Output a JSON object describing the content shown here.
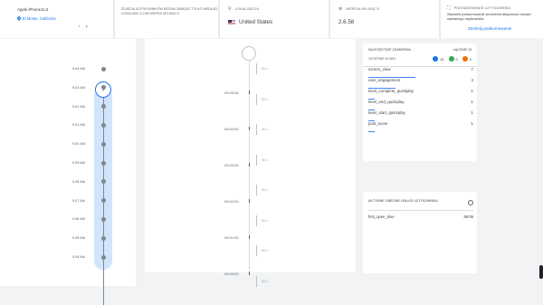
{
  "device": {
    "name": "Apple iPhone11,6",
    "location": "El Monte, California",
    "prev": "‹",
    "next": "›"
  },
  "notice": {
    "text": "Zdjęcia użytkowników można zawęzić tylko według lokalizacji lub wersji aplikacji"
  },
  "location": {
    "header": "Lokalizacja",
    "value": "United States"
  },
  "app_version": {
    "header": "Wersja aplikacji",
    "value": "2.6.58"
  },
  "summary": {
    "header": "Podsumowanie użytkownika",
    "description": "Wyświetl podsumowanie strumienia aktywności losowo wybranego użytkownika",
    "close": "Zamknij podsumowanie"
  },
  "timeline": {
    "count": "0",
    "times": [
      "9:44 AM",
      "9:43 AM",
      "9:42 AM",
      "9:41 AM",
      "9:40 AM",
      "9:39 AM",
      "9:38 AM",
      "9:37 AM",
      "9:36 AM",
      "9:35 AM",
      "9:34 AM"
    ]
  },
  "events_stream": {
    "times": [
      "09:45:00",
      "09:44:00",
      "09:43:00",
      "09:42:00",
      "09:41:00",
      "09:40:00"
    ],
    "gaps": [
      "50 s",
      "60 s",
      "60 s",
      "60 s",
      "60 s",
      "60 s",
      "60 s",
      "60 s"
    ]
  },
  "latest_events": {
    "title": "Najczęstsze zdarzenia",
    "total": "Łącznie 15",
    "range": "Ostatnie 30 min",
    "badges": [
      {
        "count": "15",
        "color": "#1a73e8"
      },
      {
        "count": "0",
        "color": "#34a853"
      },
      {
        "count": "0",
        "color": "#e8710a"
      }
    ],
    "rows": [
      {
        "name": "screen_view",
        "count": "7",
        "fraction": 1.0
      },
      {
        "name": "user_engagement",
        "count": "4",
        "fraction": 0.57
      },
      {
        "name": "level_complete_quickplay",
        "count": "1",
        "fraction": 0.14
      },
      {
        "name": "level_end_quickplay",
        "count": "1",
        "fraction": 0.14
      },
      {
        "name": "level_start_quickplay",
        "count": "1",
        "fraction": 0.14
      },
      {
        "name": "post_score",
        "count": "1",
        "fraction": 0.14
      }
    ]
  },
  "active_properties": {
    "title": "Aktywne obecnie usługi użytkownika",
    "row_name": "first_open_time",
    "row_value": "86:05"
  }
}
